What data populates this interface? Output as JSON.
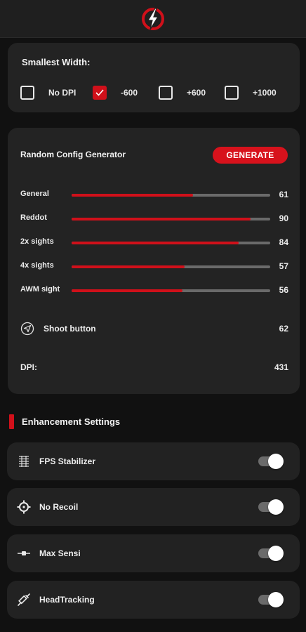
{
  "colors": {
    "accent": "#d0101a",
    "background": "#111111",
    "card": "#232323"
  },
  "smallest_width": {
    "title": "Smallest Width:",
    "options": [
      {
        "label": "No DPI",
        "checked": false
      },
      {
        "label": "-600",
        "checked": true
      },
      {
        "label": "+600",
        "checked": false
      },
      {
        "label": "+1000",
        "checked": false
      }
    ]
  },
  "generator": {
    "title": "Random Config Generator",
    "button_label": "GENERATE",
    "sliders": [
      {
        "label": "General",
        "value": "61",
        "max": 100
      },
      {
        "label": "Reddot",
        "value": "90",
        "max": 100
      },
      {
        "label": "2x sights",
        "value": "84",
        "max": 100
      },
      {
        "label": "4x sights",
        "value": "57",
        "max": 100
      },
      {
        "label": "AWM sight",
        "value": "56",
        "max": 100
      }
    ],
    "shoot_button": {
      "label": "Shoot button",
      "value": "62",
      "icon": "send-icon"
    },
    "dpi": {
      "label": "DPI:",
      "value": "431"
    }
  },
  "enhancement": {
    "title": "Enhancement Settings",
    "items": [
      {
        "label": "FPS Stabilizer",
        "icon": "fps-icon",
        "on": true
      },
      {
        "label": "No Recoil",
        "icon": "crosshair-icon",
        "on": true
      },
      {
        "label": "Max Sensi",
        "icon": "slider-icon",
        "on": true
      },
      {
        "label": "HeadTracking",
        "icon": "syringe-icon",
        "on": true
      }
    ]
  }
}
